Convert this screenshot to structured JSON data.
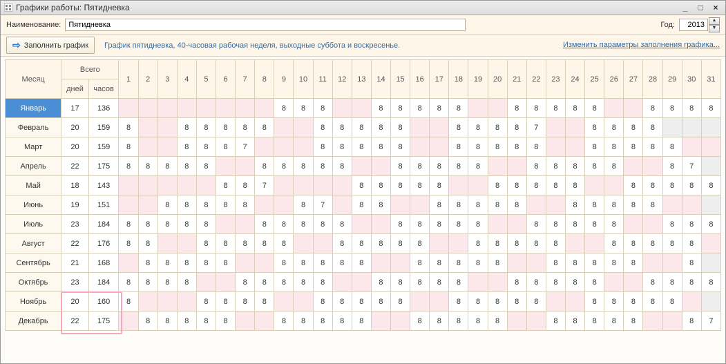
{
  "window": {
    "title": "Графики работы: Пятидневка"
  },
  "labels": {
    "name": "Наименование:",
    "year": "Год:",
    "fill": "Заполнить график",
    "desc": "График пятидневка, 40-часовая рабочая неделя, выходные суббота и воскресенье.",
    "link": "Изменить параметры заполнения\nграфика..."
  },
  "name_value": "Пятидневка",
  "year_value": "2013",
  "headers": {
    "month": "Месяц",
    "total": "Всего",
    "days": "дней",
    "hours": "часов"
  },
  "day_cols": [
    "1",
    "2",
    "3",
    "4",
    "5",
    "6",
    "7",
    "8",
    "9",
    "10",
    "11",
    "12",
    "13",
    "14",
    "15",
    "16",
    "17",
    "18",
    "19",
    "20",
    "21",
    "22",
    "23",
    "24",
    "25",
    "26",
    "27",
    "28",
    "29",
    "30",
    "31"
  ],
  "green_days": [
    25,
    26,
    27,
    28,
    29,
    30,
    31
  ],
  "months": [
    {
      "name": "Январь",
      "sel": true,
      "days": "17",
      "hours": "136",
      "cells": [
        {
          "t": "",
          "c": "wk"
        },
        {
          "t": "",
          "c": "wk"
        },
        {
          "t": "",
          "c": "wk"
        },
        {
          "t": "",
          "c": "wk"
        },
        {
          "t": "",
          "c": "wk"
        },
        {
          "t": "",
          "c": "wk"
        },
        {
          "t": "",
          "c": "wk"
        },
        {
          "t": "",
          "c": "wk"
        },
        {
          "t": "8"
        },
        {
          "t": "8"
        },
        {
          "t": "8"
        },
        {
          "t": "",
          "c": "wk"
        },
        {
          "t": "",
          "c": "wk"
        },
        {
          "t": "8"
        },
        {
          "t": "8"
        },
        {
          "t": "8"
        },
        {
          "t": "8"
        },
        {
          "t": "8"
        },
        {
          "t": "",
          "c": "wk"
        },
        {
          "t": "",
          "c": "wk"
        },
        {
          "t": "8"
        },
        {
          "t": "8"
        },
        {
          "t": "8"
        },
        {
          "t": "8"
        },
        {
          "t": "8"
        },
        {
          "t": "",
          "c": "wk"
        },
        {
          "t": "",
          "c": "wk"
        },
        {
          "t": "8"
        },
        {
          "t": "8"
        },
        {
          "t": "8"
        },
        {
          "t": "8"
        }
      ]
    },
    {
      "name": "Февраль",
      "days": "20",
      "hours": "159",
      "cells": [
        {
          "t": "8"
        },
        {
          "t": "",
          "c": "wk"
        },
        {
          "t": "",
          "c": "wk"
        },
        {
          "t": "8"
        },
        {
          "t": "8"
        },
        {
          "t": "8"
        },
        {
          "t": "8"
        },
        {
          "t": "8"
        },
        {
          "t": "",
          "c": "wk"
        },
        {
          "t": "",
          "c": "wk"
        },
        {
          "t": "8"
        },
        {
          "t": "8"
        },
        {
          "t": "8"
        },
        {
          "t": "8"
        },
        {
          "t": "8"
        },
        {
          "t": "",
          "c": "wk"
        },
        {
          "t": "",
          "c": "wk"
        },
        {
          "t": "8"
        },
        {
          "t": "8"
        },
        {
          "t": "8"
        },
        {
          "t": "8"
        },
        {
          "t": "7"
        },
        {
          "t": "",
          "c": "wk"
        },
        {
          "t": "",
          "c": "wk"
        },
        {
          "t": "8"
        },
        {
          "t": "8"
        },
        {
          "t": "8"
        },
        {
          "t": "8"
        },
        {
          "t": "",
          "c": "gr"
        },
        {
          "t": "",
          "c": "gr"
        },
        {
          "t": "",
          "c": "gr"
        }
      ]
    },
    {
      "name": "Март",
      "days": "20",
      "hours": "159",
      "cells": [
        {
          "t": "8"
        },
        {
          "t": "",
          "c": "wk"
        },
        {
          "t": "",
          "c": "wk"
        },
        {
          "t": "8"
        },
        {
          "t": "8"
        },
        {
          "t": "8"
        },
        {
          "t": "7"
        },
        {
          "t": "",
          "c": "wk"
        },
        {
          "t": "",
          "c": "wk"
        },
        {
          "t": "",
          "c": "wk"
        },
        {
          "t": "8"
        },
        {
          "t": "8"
        },
        {
          "t": "8"
        },
        {
          "t": "8"
        },
        {
          "t": "8"
        },
        {
          "t": "",
          "c": "wk"
        },
        {
          "t": "",
          "c": "wk"
        },
        {
          "t": "8"
        },
        {
          "t": "8"
        },
        {
          "t": "8"
        },
        {
          "t": "8"
        },
        {
          "t": "8"
        },
        {
          "t": "",
          "c": "wk"
        },
        {
          "t": "",
          "c": "wk"
        },
        {
          "t": "8"
        },
        {
          "t": "8"
        },
        {
          "t": "8"
        },
        {
          "t": "8"
        },
        {
          "t": "8"
        },
        {
          "t": "",
          "c": "wk"
        },
        {
          "t": "",
          "c": "wk"
        }
      ]
    },
    {
      "name": "Апрель",
      "days": "22",
      "hours": "175",
      "cells": [
        {
          "t": "8"
        },
        {
          "t": "8"
        },
        {
          "t": "8"
        },
        {
          "t": "8"
        },
        {
          "t": "8"
        },
        {
          "t": "",
          "c": "wk"
        },
        {
          "t": "",
          "c": "wk"
        },
        {
          "t": "8"
        },
        {
          "t": "8"
        },
        {
          "t": "8"
        },
        {
          "t": "8"
        },
        {
          "t": "8"
        },
        {
          "t": "",
          "c": "wk"
        },
        {
          "t": "",
          "c": "wk"
        },
        {
          "t": "8"
        },
        {
          "t": "8"
        },
        {
          "t": "8"
        },
        {
          "t": "8"
        },
        {
          "t": "8"
        },
        {
          "t": "",
          "c": "wk"
        },
        {
          "t": "",
          "c": "wk"
        },
        {
          "t": "8"
        },
        {
          "t": "8"
        },
        {
          "t": "8"
        },
        {
          "t": "8"
        },
        {
          "t": "8"
        },
        {
          "t": "",
          "c": "wk"
        },
        {
          "t": "",
          "c": "wk"
        },
        {
          "t": "8"
        },
        {
          "t": "7"
        },
        {
          "t": "",
          "c": "gr"
        }
      ]
    },
    {
      "name": "Май",
      "days": "18",
      "hours": "143",
      "cells": [
        {
          "t": "",
          "c": "wk"
        },
        {
          "t": "",
          "c": "wk"
        },
        {
          "t": "",
          "c": "wk"
        },
        {
          "t": "",
          "c": "wk"
        },
        {
          "t": "",
          "c": "wk"
        },
        {
          "t": "8"
        },
        {
          "t": "8"
        },
        {
          "t": "7"
        },
        {
          "t": "",
          "c": "wk"
        },
        {
          "t": "",
          "c": "wk"
        },
        {
          "t": "",
          "c": "wk"
        },
        {
          "t": "",
          "c": "wk"
        },
        {
          "t": "8"
        },
        {
          "t": "8"
        },
        {
          "t": "8"
        },
        {
          "t": "8"
        },
        {
          "t": "8"
        },
        {
          "t": "",
          "c": "wk"
        },
        {
          "t": "",
          "c": "wk"
        },
        {
          "t": "8"
        },
        {
          "t": "8"
        },
        {
          "t": "8"
        },
        {
          "t": "8"
        },
        {
          "t": "8"
        },
        {
          "t": "",
          "c": "wk"
        },
        {
          "t": "",
          "c": "wk"
        },
        {
          "t": "8"
        },
        {
          "t": "8"
        },
        {
          "t": "8"
        },
        {
          "t": "8"
        },
        {
          "t": "8"
        }
      ]
    },
    {
      "name": "Июнь",
      "days": "19",
      "hours": "151",
      "cells": [
        {
          "t": "",
          "c": "wk"
        },
        {
          "t": "",
          "c": "wk"
        },
        {
          "t": "8"
        },
        {
          "t": "8"
        },
        {
          "t": "8"
        },
        {
          "t": "8"
        },
        {
          "t": "8"
        },
        {
          "t": "",
          "c": "wk"
        },
        {
          "t": "",
          "c": "wk"
        },
        {
          "t": "8"
        },
        {
          "t": "7"
        },
        {
          "t": "",
          "c": "wk"
        },
        {
          "t": "8"
        },
        {
          "t": "8"
        },
        {
          "t": "",
          "c": "wk"
        },
        {
          "t": "",
          "c": "wk"
        },
        {
          "t": "8"
        },
        {
          "t": "8"
        },
        {
          "t": "8"
        },
        {
          "t": "8"
        },
        {
          "t": "8"
        },
        {
          "t": "",
          "c": "wk"
        },
        {
          "t": "",
          "c": "wk"
        },
        {
          "t": "8"
        },
        {
          "t": "8"
        },
        {
          "t": "8"
        },
        {
          "t": "8"
        },
        {
          "t": "8"
        },
        {
          "t": "",
          "c": "wk"
        },
        {
          "t": "",
          "c": "wk"
        },
        {
          "t": "",
          "c": "gr"
        }
      ]
    },
    {
      "name": "Июль",
      "days": "23",
      "hours": "184",
      "cells": [
        {
          "t": "8"
        },
        {
          "t": "8"
        },
        {
          "t": "8"
        },
        {
          "t": "8"
        },
        {
          "t": "8"
        },
        {
          "t": "",
          "c": "wk"
        },
        {
          "t": "",
          "c": "wk"
        },
        {
          "t": "8"
        },
        {
          "t": "8"
        },
        {
          "t": "8"
        },
        {
          "t": "8"
        },
        {
          "t": "8"
        },
        {
          "t": "",
          "c": "wk"
        },
        {
          "t": "",
          "c": "wk"
        },
        {
          "t": "8"
        },
        {
          "t": "8"
        },
        {
          "t": "8"
        },
        {
          "t": "8"
        },
        {
          "t": "8"
        },
        {
          "t": "",
          "c": "wk"
        },
        {
          "t": "",
          "c": "wk"
        },
        {
          "t": "8"
        },
        {
          "t": "8"
        },
        {
          "t": "8"
        },
        {
          "t": "8"
        },
        {
          "t": "8"
        },
        {
          "t": "",
          "c": "wk"
        },
        {
          "t": "",
          "c": "wk"
        },
        {
          "t": "8"
        },
        {
          "t": "8"
        },
        {
          "t": "8"
        }
      ]
    },
    {
      "name": "Август",
      "days": "22",
      "hours": "176",
      "cells": [
        {
          "t": "8"
        },
        {
          "t": "8"
        },
        {
          "t": "",
          "c": "wk"
        },
        {
          "t": "",
          "c": "wk"
        },
        {
          "t": "8"
        },
        {
          "t": "8"
        },
        {
          "t": "8"
        },
        {
          "t": "8"
        },
        {
          "t": "8"
        },
        {
          "t": "",
          "c": "wk"
        },
        {
          "t": "",
          "c": "wk"
        },
        {
          "t": "8"
        },
        {
          "t": "8"
        },
        {
          "t": "8"
        },
        {
          "t": "8"
        },
        {
          "t": "8"
        },
        {
          "t": "",
          "c": "wk"
        },
        {
          "t": "",
          "c": "wk"
        },
        {
          "t": "8"
        },
        {
          "t": "8"
        },
        {
          "t": "8"
        },
        {
          "t": "8"
        },
        {
          "t": "8"
        },
        {
          "t": "",
          "c": "wk"
        },
        {
          "t": "",
          "c": "wk"
        },
        {
          "t": "8"
        },
        {
          "t": "8"
        },
        {
          "t": "8"
        },
        {
          "t": "8"
        },
        {
          "t": "8"
        },
        {
          "t": "",
          "c": "wk"
        }
      ]
    },
    {
      "name": "Сентябрь",
      "days": "21",
      "hours": "168",
      "cells": [
        {
          "t": "",
          "c": "wk"
        },
        {
          "t": "8"
        },
        {
          "t": "8"
        },
        {
          "t": "8"
        },
        {
          "t": "8"
        },
        {
          "t": "8"
        },
        {
          "t": "",
          "c": "wk"
        },
        {
          "t": "",
          "c": "wk"
        },
        {
          "t": "8"
        },
        {
          "t": "8"
        },
        {
          "t": "8"
        },
        {
          "t": "8"
        },
        {
          "t": "8"
        },
        {
          "t": "",
          "c": "wk"
        },
        {
          "t": "",
          "c": "wk"
        },
        {
          "t": "8"
        },
        {
          "t": "8"
        },
        {
          "t": "8"
        },
        {
          "t": "8"
        },
        {
          "t": "8"
        },
        {
          "t": "",
          "c": "wk"
        },
        {
          "t": "",
          "c": "wk"
        },
        {
          "t": "8"
        },
        {
          "t": "8"
        },
        {
          "t": "8"
        },
        {
          "t": "8"
        },
        {
          "t": "8"
        },
        {
          "t": "",
          "c": "wk"
        },
        {
          "t": "",
          "c": "wk"
        },
        {
          "t": "8"
        },
        {
          "t": "",
          "c": "gr"
        }
      ]
    },
    {
      "name": "Октябрь",
      "days": "23",
      "hours": "184",
      "cells": [
        {
          "t": "8"
        },
        {
          "t": "8"
        },
        {
          "t": "8"
        },
        {
          "t": "8"
        },
        {
          "t": "",
          "c": "wk"
        },
        {
          "t": "",
          "c": "wk"
        },
        {
          "t": "8"
        },
        {
          "t": "8"
        },
        {
          "t": "8"
        },
        {
          "t": "8"
        },
        {
          "t": "8"
        },
        {
          "t": "",
          "c": "wk"
        },
        {
          "t": "",
          "c": "wk"
        },
        {
          "t": "8"
        },
        {
          "t": "8"
        },
        {
          "t": "8"
        },
        {
          "t": "8"
        },
        {
          "t": "8"
        },
        {
          "t": "",
          "c": "wk"
        },
        {
          "t": "",
          "c": "wk"
        },
        {
          "t": "8"
        },
        {
          "t": "8"
        },
        {
          "t": "8"
        },
        {
          "t": "8"
        },
        {
          "t": "8"
        },
        {
          "t": "",
          "c": "wk"
        },
        {
          "t": "",
          "c": "wk"
        },
        {
          "t": "8"
        },
        {
          "t": "8"
        },
        {
          "t": "8"
        },
        {
          "t": "8"
        }
      ]
    },
    {
      "name": "Ноябрь",
      "days": "20",
      "hours": "160",
      "cells": [
        {
          "t": "8"
        },
        {
          "t": "",
          "c": "wk"
        },
        {
          "t": "",
          "c": "wk"
        },
        {
          "t": "",
          "c": "wk"
        },
        {
          "t": "8"
        },
        {
          "t": "8"
        },
        {
          "t": "8"
        },
        {
          "t": "8"
        },
        {
          "t": "",
          "c": "wk"
        },
        {
          "t": "",
          "c": "wk"
        },
        {
          "t": "8"
        },
        {
          "t": "8"
        },
        {
          "t": "8"
        },
        {
          "t": "8"
        },
        {
          "t": "8"
        },
        {
          "t": "",
          "c": "wk"
        },
        {
          "t": "",
          "c": "wk"
        },
        {
          "t": "8"
        },
        {
          "t": "8"
        },
        {
          "t": "8"
        },
        {
          "t": "8"
        },
        {
          "t": "8"
        },
        {
          "t": "",
          "c": "wk"
        },
        {
          "t": "",
          "c": "wk"
        },
        {
          "t": "8"
        },
        {
          "t": "8"
        },
        {
          "t": "8"
        },
        {
          "t": "8"
        },
        {
          "t": "8"
        },
        {
          "t": "",
          "c": "wk"
        },
        {
          "t": "",
          "c": "gr"
        }
      ]
    },
    {
      "name": "Декабрь",
      "days": "22",
      "hours": "175",
      "cells": [
        {
          "t": "",
          "c": "wk"
        },
        {
          "t": "8"
        },
        {
          "t": "8"
        },
        {
          "t": "8"
        },
        {
          "t": "8"
        },
        {
          "t": "8"
        },
        {
          "t": "",
          "c": "wk"
        },
        {
          "t": "",
          "c": "wk"
        },
        {
          "t": "8"
        },
        {
          "t": "8"
        },
        {
          "t": "8"
        },
        {
          "t": "8"
        },
        {
          "t": "8"
        },
        {
          "t": "",
          "c": "wk"
        },
        {
          "t": "",
          "c": "wk"
        },
        {
          "t": "8"
        },
        {
          "t": "8"
        },
        {
          "t": "8"
        },
        {
          "t": "8"
        },
        {
          "t": "8"
        },
        {
          "t": "",
          "c": "wk"
        },
        {
          "t": "",
          "c": "wk"
        },
        {
          "t": "8"
        },
        {
          "t": "8"
        },
        {
          "t": "8"
        },
        {
          "t": "8"
        },
        {
          "t": "8"
        },
        {
          "t": "",
          "c": "wk"
        },
        {
          "t": "",
          "c": "wk"
        },
        {
          "t": "8"
        },
        {
          "t": "7"
        }
      ]
    }
  ]
}
